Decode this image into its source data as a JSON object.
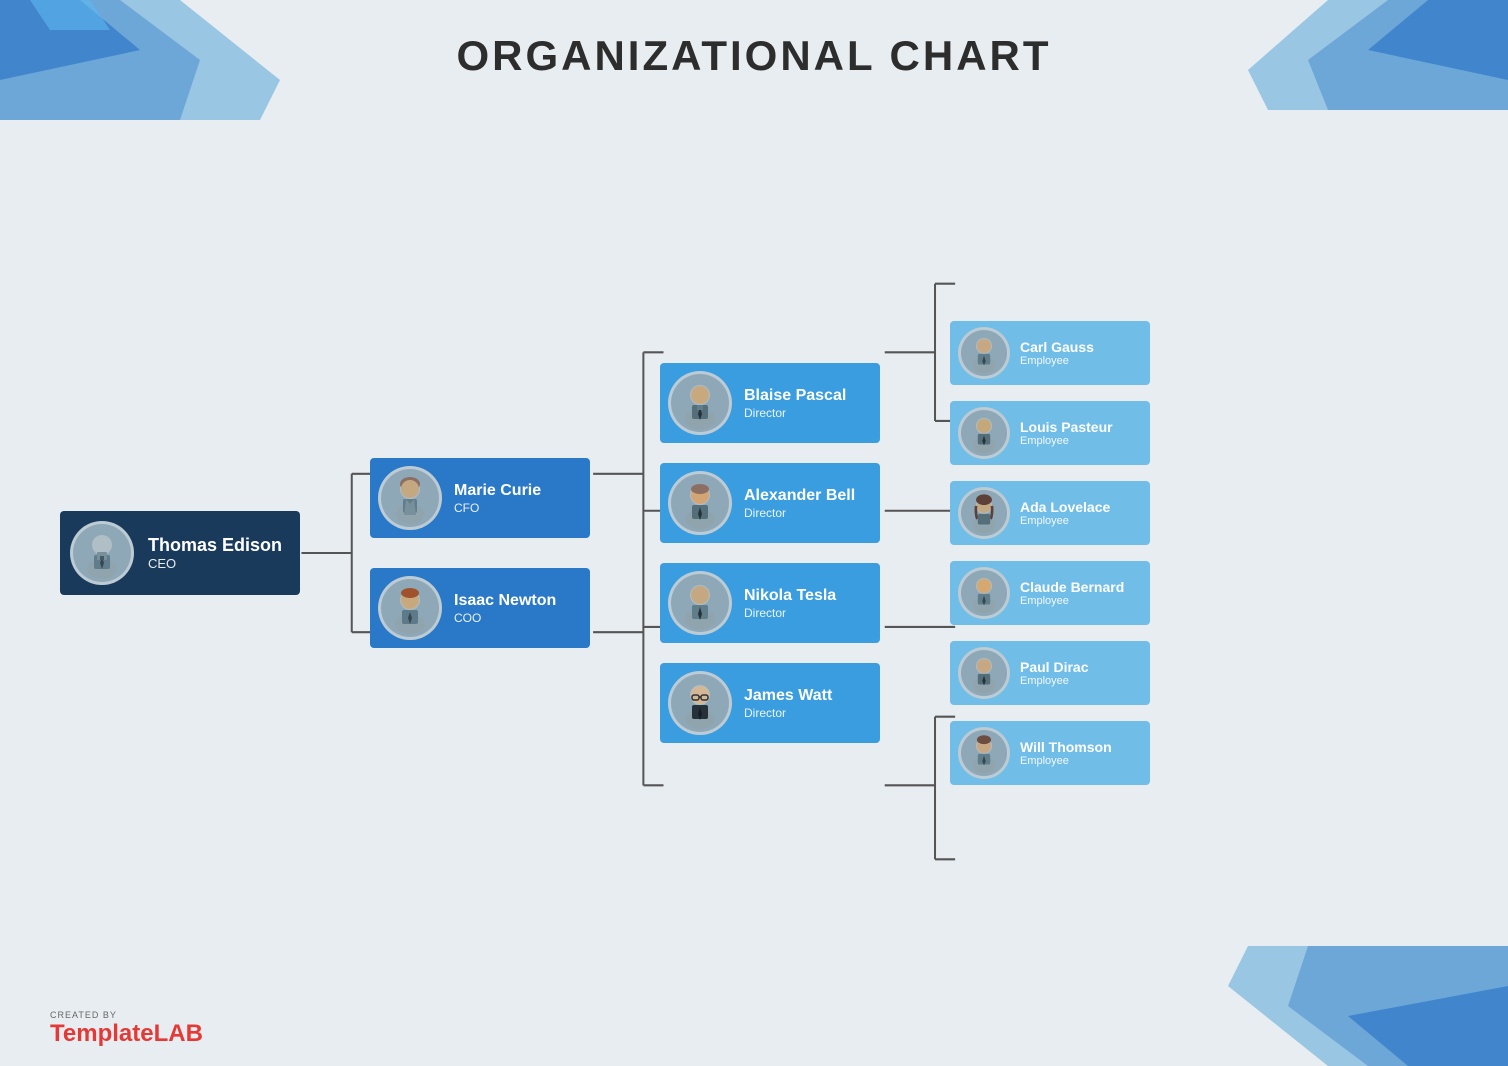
{
  "title": "ORGANIZATIONAL CHART",
  "ceo": {
    "name": "Thomas Edison",
    "role": "CEO"
  },
  "level2": [
    {
      "name": "Marie Curie",
      "role": "CFO"
    },
    {
      "name": "Isaac Newton",
      "role": "COO"
    }
  ],
  "directors": [
    {
      "name": "Blaise Pascal",
      "role": "Director"
    },
    {
      "name": "Alexander Bell",
      "role": "Director"
    },
    {
      "name": "Nikola Tesla",
      "role": "Director"
    },
    {
      "name": "James Watt",
      "role": "Director"
    }
  ],
  "employees": [
    {
      "name": "Carl Gauss",
      "role": "Employee"
    },
    {
      "name": "Louis Pasteur",
      "role": "Employee"
    },
    {
      "name": "Ada Lovelace",
      "role": "Employee"
    },
    {
      "name": "Claude Bernard",
      "role": "Employee"
    },
    {
      "name": "Paul Dirac",
      "role": "Employee"
    },
    {
      "name": "Will Thomson",
      "role": "Employee"
    }
  ],
  "branding": {
    "created_by": "CREATED BY",
    "brand_template": "Template",
    "brand_lab": "LAB"
  },
  "colors": {
    "ceo_bg": "#1a3a5c",
    "mid_bg": "#2979c8",
    "director_bg": "#3a9de0",
    "employee_bg": "#70bde8",
    "connector": "#555"
  }
}
